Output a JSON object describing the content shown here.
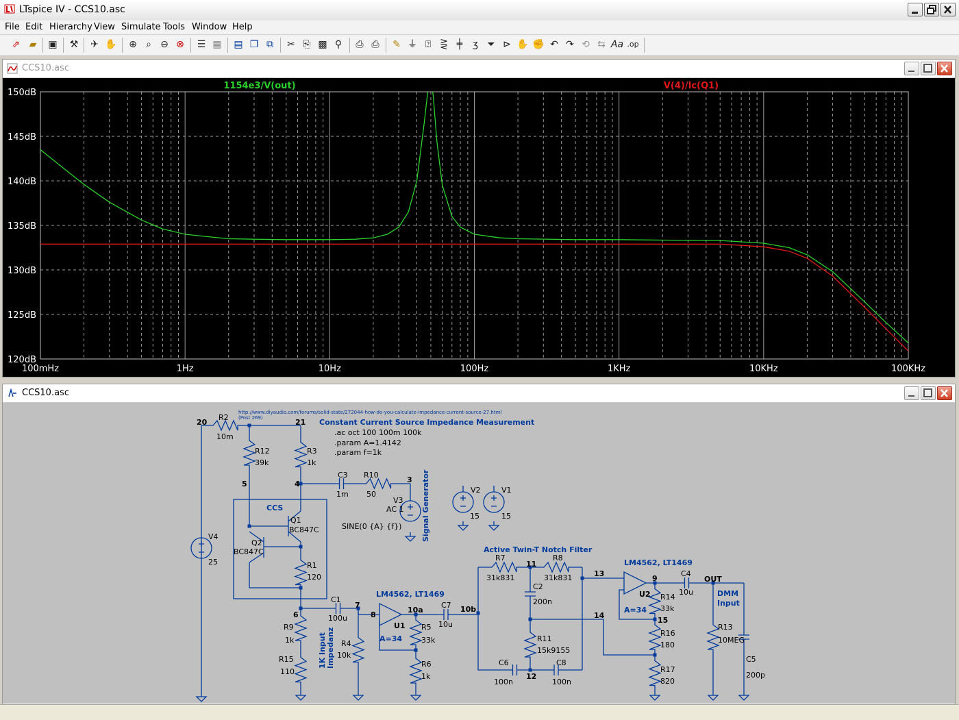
{
  "app": {
    "title": "LTspice IV - CCS10.asc"
  },
  "menu": [
    "File",
    "Edit",
    "Hierarchy",
    "View",
    "Simulate",
    "Tools",
    "Window",
    "Help"
  ],
  "toolbar_icons": [
    "run-icon",
    "open-icon",
    "save-icon",
    "control-panel-icon",
    "halt-icon",
    "pan-icon",
    "zoom-in-icon",
    "zoom-area-icon",
    "zoom-out-icon",
    "zoom-cancel-icon",
    "autorange-icon",
    "grid-icon",
    "tile-horizontal-icon",
    "cascade-icon",
    "tile-icon",
    "cut-icon",
    "copy-icon",
    "paste-icon",
    "find-icon",
    "print-setup-icon",
    "print-icon",
    "wire-icon",
    "ground-icon",
    "label-icon",
    "resistor-icon",
    "capacitor-icon",
    "inductor-icon",
    "diode-icon",
    "component-icon",
    "move-icon",
    "drag-icon",
    "undo-icon",
    "redo-icon",
    "rotate-icon",
    "mirror-icon",
    "text-icon",
    "spice-directive-icon"
  ],
  "plot_window": {
    "title": "CCS10.asc",
    "trace1_label": "1154e3/V(out)",
    "trace2_label": "V(4)/Ic(Q1)",
    "colors": {
      "background": "#000000",
      "grid": "#9a9a9a",
      "trace1": "#2ad12a",
      "trace2": "#e01818"
    }
  },
  "chart_data": {
    "type": "line",
    "xscale": "log",
    "x_range": [
      0.1,
      100000
    ],
    "y_range": [
      120,
      150
    ],
    "x_ticks": [
      "100mHz",
      "1Hz",
      "10Hz",
      "100Hz",
      "1KHz",
      "10KHz",
      "100KHz"
    ],
    "y_ticks": [
      "150dB",
      "145dB",
      "140dB",
      "135dB",
      "130dB",
      "125dB",
      "120dB"
    ],
    "series": [
      {
        "name": "1154e3/V(out)",
        "color": "#2ad12a",
        "x": [
          0.1,
          0.15,
          0.2,
          0.3,
          0.5,
          0.7,
          1,
          1.5,
          2,
          3,
          5,
          7,
          10,
          15,
          20,
          25,
          30,
          35,
          40,
          45,
          48,
          50,
          52,
          55,
          60,
          70,
          80,
          100,
          150,
          200,
          500,
          1000,
          2000,
          5000,
          10000,
          15000,
          20000,
          30000,
          50000,
          70000,
          100000
        ],
        "y": [
          143.5,
          141.2,
          139.6,
          137.6,
          135.6,
          134.6,
          134.0,
          133.7,
          133.5,
          133.45,
          133.4,
          133.4,
          133.4,
          133.45,
          133.6,
          134.0,
          134.8,
          136.5,
          140.0,
          146.5,
          150.5,
          151.5,
          149.5,
          144.5,
          139.5,
          136.0,
          134.8,
          134.0,
          133.6,
          133.5,
          133.4,
          133.4,
          133.35,
          133.3,
          133.0,
          132.5,
          131.7,
          129.8,
          126.4,
          124.1,
          121.8
        ]
      },
      {
        "name": "V(4)/Ic(Q1)",
        "color": "#e01818",
        "x": [
          0.1,
          1,
          10,
          100,
          1000,
          5000,
          10000,
          15000,
          20000,
          30000,
          50000,
          70000,
          100000
        ],
        "y": [
          132.9,
          132.9,
          132.9,
          132.9,
          132.9,
          132.9,
          132.6,
          132.1,
          131.3,
          129.3,
          125.8,
          123.4,
          120.9
        ]
      }
    ]
  },
  "schematic_window": {
    "title": "CCS10.asc",
    "texts": {
      "url": "http://www.diyaudio.com/forums/solid-state/272044-how-do-you-calculate-impedance-current-source-27.html",
      "post": "(Post 269)",
      "heading": "Constant Current Source Impedance Measurement",
      "dir1": ".ac oct 100 100m 100k",
      "dir2": ".param A=1.4142",
      "dir3": ".param f=1k",
      "ccs": "CCS",
      "siggen": "Signal Generator",
      "v3val": "SINE(0 {A} {f})",
      "v3ac": "AC 1",
      "notch": "Active Twin-T Notch Filter",
      "opamp1": "LM4562, LT1469",
      "opamp2": "LM4562, LT1469",
      "gain1": "A=34",
      "gain2": "A=34",
      "input": "1K Input",
      "impedanz": "Impedanz",
      "dmm": "DMM",
      "dmm2": "Input",
      "out": "OUT"
    },
    "components": {
      "R2": [
        "R2",
        "10m"
      ],
      "R12": [
        "R12",
        "39k"
      ],
      "R3": [
        "R3",
        "1k"
      ],
      "R1": [
        "R1",
        "120"
      ],
      "R9": [
        "R9",
        "1k"
      ],
      "R15": [
        "R15",
        "110"
      ],
      "R4": [
        "R4",
        "10k"
      ],
      "R5": [
        "R5",
        "33k"
      ],
      "R6": [
        "R6",
        "1k"
      ],
      "R10": [
        "R10",
        "50"
      ],
      "R7": [
        "R7",
        "31k831"
      ],
      "R8": [
        "R8",
        "31k831"
      ],
      "R11": [
        "R11",
        "15k9155"
      ],
      "R14": [
        "R14",
        "33k"
      ],
      "R16": [
        "R16",
        "180"
      ],
      "R17": [
        "R17",
        "820"
      ],
      "R13": [
        "R13",
        "10MEG"
      ],
      "C1": [
        "C1",
        "100u"
      ],
      "C2": [
        "C2",
        "200n"
      ],
      "C3": [
        "C3",
        "1m"
      ],
      "C4": [
        "C4",
        "10u"
      ],
      "C5": [
        "C5",
        "200p"
      ],
      "C6": [
        "C6",
        "100n"
      ],
      "C7": [
        "C7",
        "10u"
      ],
      "C8": [
        "C8",
        "100n"
      ],
      "V1": [
        "V1",
        "15"
      ],
      "V2": [
        "V2",
        "15"
      ],
      "V3": [
        "V3",
        ""
      ],
      "V4": [
        "V4",
        "25"
      ],
      "Q1": [
        "Q1",
        "BC847C"
      ],
      "Q2": [
        "Q2",
        "BC847C"
      ],
      "U1": [
        "U1",
        ""
      ],
      "U2": [
        "U2",
        ""
      ]
    },
    "nodes": [
      "20",
      "21",
      "5",
      "4",
      "3",
      "6",
      "7",
      "8",
      "10a",
      "10b",
      "11",
      "12",
      "13",
      "14",
      "9",
      "15"
    ]
  }
}
